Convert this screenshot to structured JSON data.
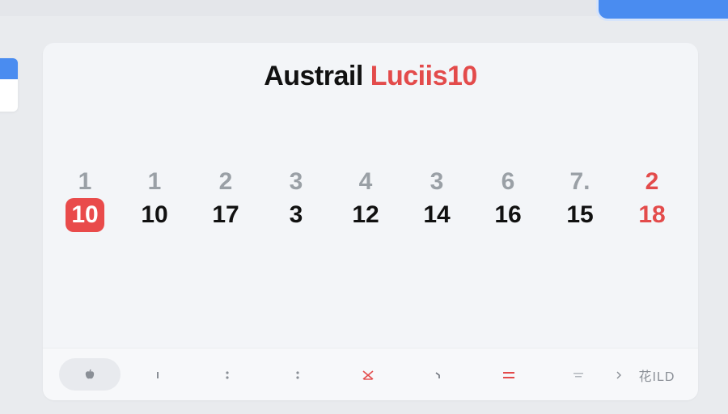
{
  "title": {
    "primary": "Austrail",
    "accent": "Luciis10"
  },
  "days": [
    {
      "weekday": "1",
      "date": "10",
      "selected": true,
      "weekend": false
    },
    {
      "weekday": "1",
      "date": "10",
      "selected": false,
      "weekend": false
    },
    {
      "weekday": "2",
      "date": "17",
      "selected": false,
      "weekend": false
    },
    {
      "weekday": "3",
      "date": "3",
      "selected": false,
      "weekend": false
    },
    {
      "weekday": "4",
      "date": "12",
      "selected": false,
      "weekend": false
    },
    {
      "weekday": "3",
      "date": "14",
      "selected": false,
      "weekend": false
    },
    {
      "weekday": "6",
      "date": "16",
      "selected": false,
      "weekend": false
    },
    {
      "weekday": "7.",
      "date": "15",
      "selected": false,
      "weekend": false
    },
    {
      "weekday": "2",
      "date": "18",
      "selected": false,
      "weekend": true
    }
  ],
  "bottom_bar": {
    "items": [
      {
        "icon": "apple-icon"
      },
      {
        "icon": "bar-icon"
      },
      {
        "icon": "colon-icon"
      },
      {
        "icon": "colon-icon"
      },
      {
        "icon": "alarm-icon"
      },
      {
        "icon": "hook-icon"
      },
      {
        "icon": "equals-icon"
      },
      {
        "icon": "filter-icon"
      },
      {
        "icon": "chevron-right-icon"
      }
    ],
    "label": "花ILD"
  },
  "colors": {
    "accent_red": "#e34b4b",
    "accent_blue": "#4a8cf0",
    "card_bg": "#f3f5f8"
  }
}
